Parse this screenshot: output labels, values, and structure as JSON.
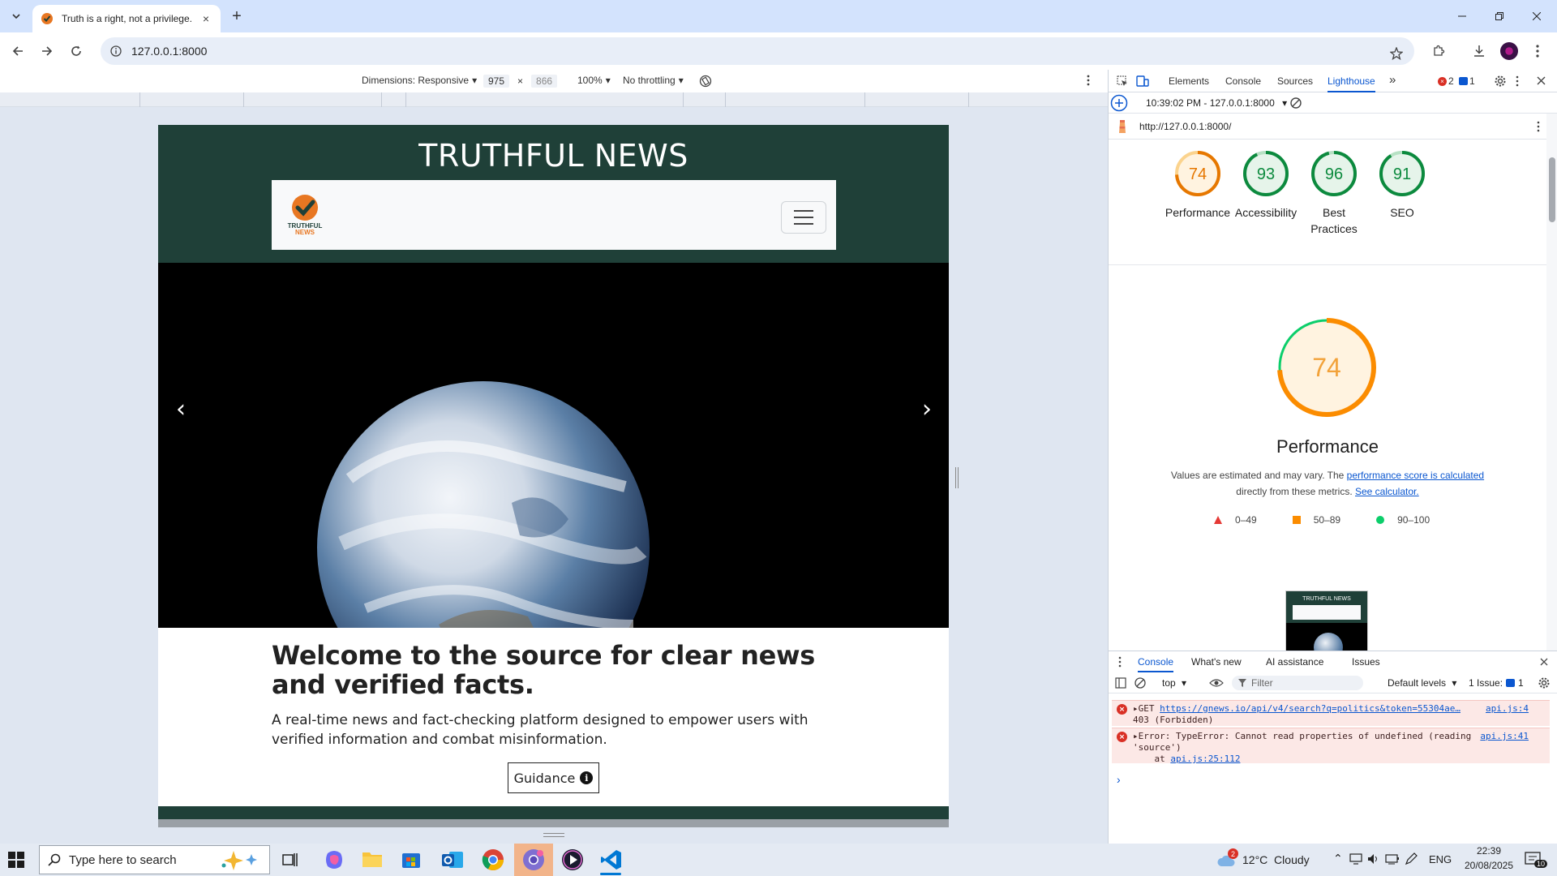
{
  "browser": {
    "tab_title": "Truth is a right, not a privilege.",
    "url": "127.0.0.1:8000",
    "new_tab": "+",
    "close_tab": "×"
  },
  "device_toolbar": {
    "dimensions_label": "Dimensions: Responsive",
    "width": "975",
    "times": "×",
    "height": "866",
    "zoom": "100%",
    "throttling": "No throttling"
  },
  "site": {
    "title": "TRUTHFUL NEWS",
    "logo_line1": "TRUTHFUL",
    "logo_line2": "NEWS",
    "prev": "‹",
    "next": "›",
    "welcome": "Welcome to the source for clear news and verified facts.",
    "intro": "A real-time news and fact-checking platform designed to empower users with verified information and combat misinformation.",
    "guidance": "Guidance",
    "info_glyph": "i"
  },
  "devtools": {
    "tabs": [
      "Elements",
      "Console",
      "Sources",
      "Lighthouse"
    ],
    "more_tabs": "»",
    "error_count": "2",
    "issue_count": "1",
    "report_time": "10:39:02 PM - 127.0.0.1:8000",
    "report_url": "http://127.0.0.1:8000/",
    "scores": [
      {
        "label": "Performance",
        "value": 74,
        "color": "#e67700",
        "fill": "#fff3e0",
        "track": "#fbd38d"
      },
      {
        "label": "Accessibility",
        "value": 93,
        "color": "#0c8a3e",
        "fill": "#e6f4ea",
        "track": "#b7e1c4"
      },
      {
        "label": "Best Practices",
        "value": 96,
        "color": "#0c8a3e",
        "fill": "#e6f4ea",
        "track": "#b7e1c4"
      },
      {
        "label": "SEO",
        "value": 91,
        "color": "#0c8a3e",
        "fill": "#e6f4ea",
        "track": "#b7e1c4"
      }
    ],
    "main_score": 74,
    "main_label": "Performance",
    "note_prefix": "Values are estimated and may vary. The ",
    "note_link1": "performance score is calculated",
    "note_middle": "directly from these metrics. ",
    "note_link2": "See calculator.",
    "legend": [
      "0–49",
      "50–89",
      "90–100"
    ],
    "thumb_title": "TRUTHFUL NEWS",
    "drawer_tabs": [
      "Console",
      "What's new",
      "AI assistance",
      "Issues"
    ],
    "context": "top",
    "filter_placeholder": "Filter",
    "levels": "Default levels",
    "issues_label": "1 Issue:",
    "issues_count": "1",
    "messages": [
      {
        "text1": "GET ",
        "link": "https://gnews.io/api/v4/search?q=politics&token=55304ae…",
        "text2": "403 (Forbidden)",
        "source": "api.js:4"
      },
      {
        "text1": "Error: TypeError: Cannot read properties of undefined (reading",
        "text2": "'source')",
        "text3": "    at ",
        "link": "api.js:25:112",
        "source": "api.js:41"
      }
    ],
    "prompt": "›"
  },
  "taskbar": {
    "search_placeholder": "Type here to search",
    "weather": "12°C  Cloudy",
    "weather_badge": "2",
    "lang": "ENG",
    "time": "22:39",
    "date": "20/08/2025",
    "notifications": "10"
  }
}
